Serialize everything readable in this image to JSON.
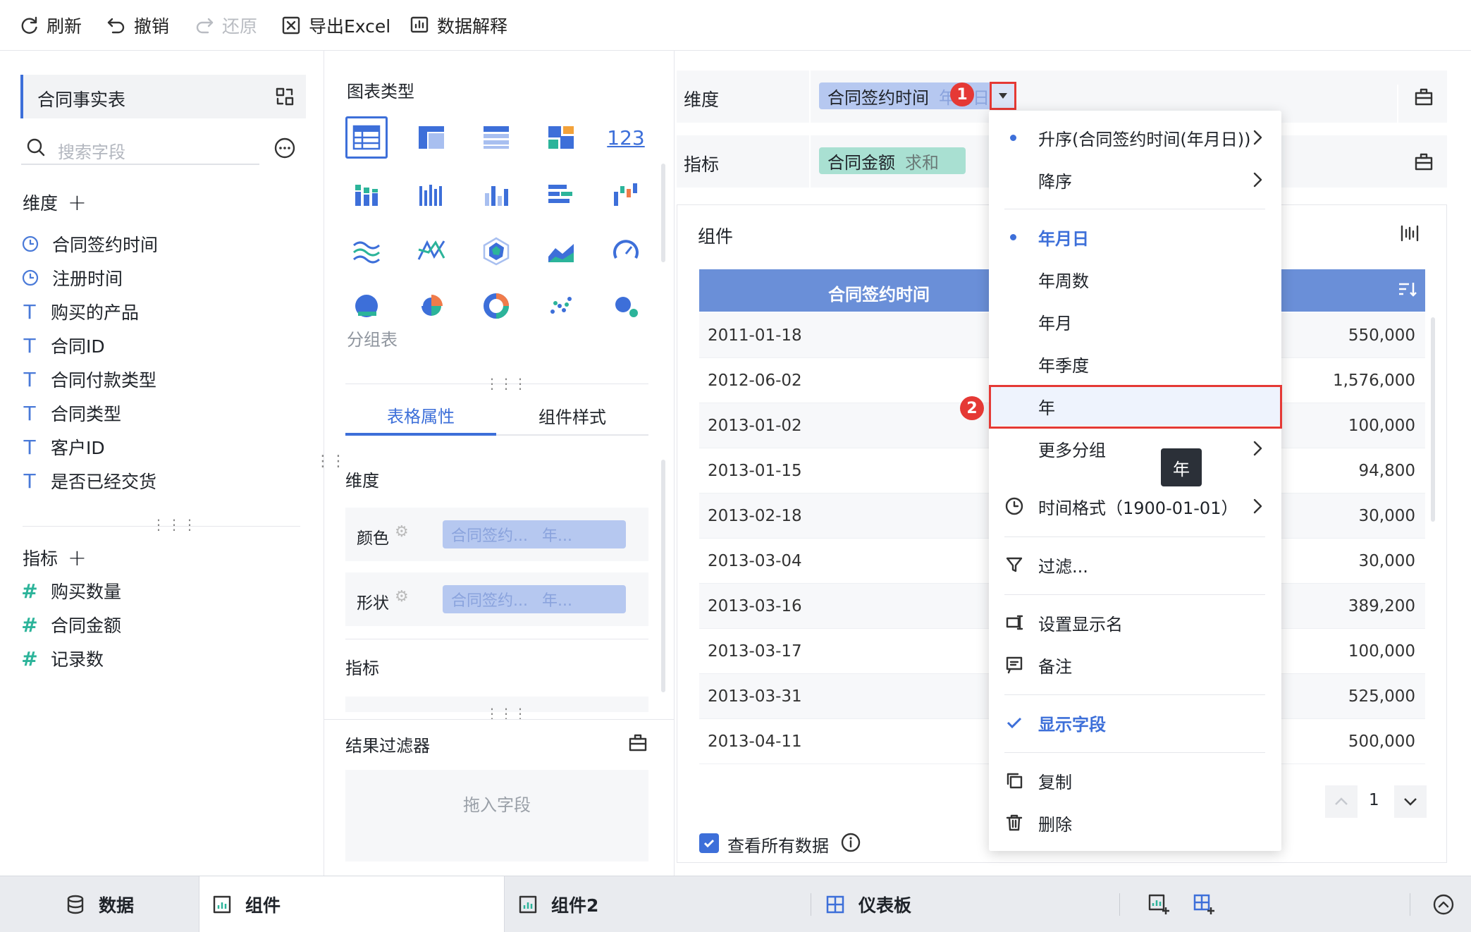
{
  "toolbar": {
    "refresh": "刷新",
    "undo": "撤销",
    "redo": "还原",
    "export_excel": "导出Excel",
    "data_explain": "数据解释"
  },
  "left_panel": {
    "table_name": "合同事实表",
    "search_placeholder": "搜索字段",
    "dimension_title": "维度",
    "dimensions": [
      {
        "name": "合同签约时间",
        "type": "time"
      },
      {
        "name": "注册时间",
        "type": "time"
      },
      {
        "name": "购买的产品",
        "type": "text"
      },
      {
        "name": "合同ID",
        "type": "text"
      },
      {
        "name": "合同付款类型",
        "type": "text"
      },
      {
        "name": "合同类型",
        "type": "text"
      },
      {
        "name": "客户ID",
        "type": "text"
      },
      {
        "name": "是否已经交货",
        "type": "text"
      }
    ],
    "measure_title": "指标",
    "measures": [
      {
        "name": "购买数量"
      },
      {
        "name": "合同金额"
      },
      {
        "name": "记录数"
      }
    ]
  },
  "middle_panel": {
    "chart_type_title": "图表类型",
    "current_chart": "分组表",
    "kpi_label": "123",
    "tabs": [
      "表格属性",
      "组件样式"
    ],
    "dimension_section": "维度",
    "color_label": "颜色",
    "shape_label": "形状",
    "color_pill": {
      "field": "合同签约...",
      "suffix": "年..."
    },
    "shape_pill": {
      "field": "合同签约...",
      "suffix": "年..."
    },
    "measure_section": "指标",
    "filter_title": "结果过滤器",
    "filter_placeholder": "拖入字段"
  },
  "right_panel": {
    "dimension_label": "维度",
    "dimension_chip": {
      "field": "合同签约时间",
      "suffix": "年月日"
    },
    "measure_label": "指标",
    "measure_chip": {
      "field": "合同金额",
      "agg": "求和"
    },
    "component_title": "组件",
    "table_header": "合同签约时间",
    "rows": [
      {
        "date": "2011-01-18",
        "value": "550,000"
      },
      {
        "date": "2012-06-02",
        "value": "1,576,000"
      },
      {
        "date": "2013-01-02",
        "value": "100,000"
      },
      {
        "date": "2013-01-15",
        "value": "94,800"
      },
      {
        "date": "2013-02-18",
        "value": "30,000"
      },
      {
        "date": "2013-03-04",
        "value": "30,000"
      },
      {
        "date": "2013-03-16",
        "value": "389,200"
      },
      {
        "date": "2013-03-17",
        "value": "100,000"
      },
      {
        "date": "2013-03-31",
        "value": "525,000"
      },
      {
        "date": "2013-04-11",
        "value": "500,000"
      }
    ],
    "page_number": "1",
    "view_all_label": "查看所有数据"
  },
  "dropdown_menu": {
    "sort_asc": "升序(合同签约时间(年月日))",
    "sort_desc": "降序",
    "group_ymd": "年月日",
    "group_yw": "年周数",
    "group_ym": "年月",
    "group_yq": "年季度",
    "group_y": "年",
    "more_group": "更多分组",
    "time_format": "时间格式（1900-01-01）",
    "filter": "过滤...",
    "set_display_name": "设置显示名",
    "note": "备注",
    "show_field": "显示字段",
    "copy": "复制",
    "delete": "删除"
  },
  "tooltip": "年",
  "annotations": {
    "step1": "1",
    "step2": "2"
  },
  "bottom_tabs": {
    "data": "数据",
    "component": "组件",
    "component2": "组件2",
    "dashboard": "仪表板"
  },
  "colors": {
    "accent": "#3d6fd9",
    "header_blue": "#6a8fd8",
    "chip_blue": "#b6c8f0",
    "chip_green": "#a9e0d2",
    "highlight_red": "#e53935"
  }
}
